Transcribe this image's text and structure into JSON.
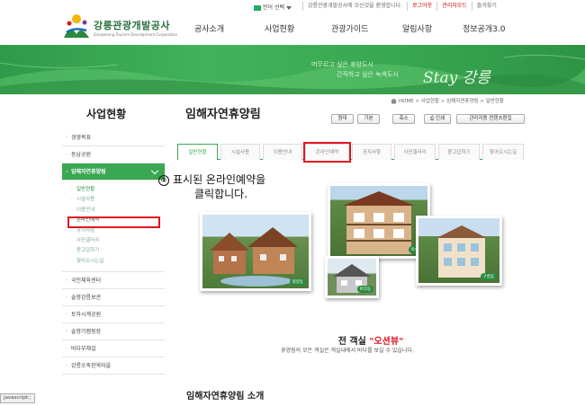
{
  "utilbar": {
    "lang_label": "언어 선택",
    "links": [
      "강릉관광개발공사에 오신것을 환영합니다.",
      "로그아웃",
      "관리자모드",
      "즐겨찾기"
    ]
  },
  "header": {
    "logo_name": "강릉관광개발공사",
    "logo_eng": "Gangneung Tourism Development Corporation",
    "gnb": [
      "공사소개",
      "사업현황",
      "관광가이드",
      "알림사항",
      "정보공개3.0"
    ]
  },
  "banner": {
    "copy1": "머무르고 싶은 휴양도시",
    "copy2": "간직하고 싶은 녹색도시",
    "stay": "Stay 강릉"
  },
  "sidebar": {
    "title": "사업현황",
    "items_top": [
      "경영목표",
      "동남공원"
    ],
    "active": "임해자연휴양림",
    "sub": [
      "일반현황",
      "시설사용",
      "이용안내",
      "온라인예약",
      "공지사항",
      "사진갤러리",
      "묻고답하기",
      "찾아오시는길"
    ],
    "items_bottom": [
      "국민체육센터",
      "솔향강릉보관",
      "토하시계공원",
      "솔향기캠핑장",
      "바다부채길",
      "강릉오죽한옥마을"
    ]
  },
  "main": {
    "page_title": "임해자연휴양림",
    "breadcrumb": [
      "HOME",
      "사업현황",
      "임해자연휴양림",
      "일반현황"
    ],
    "buttons": [
      "원대",
      "기본",
      "축소",
      "인쇄",
      "관리자용 컨텐츠편집"
    ],
    "tabs": [
      "일반현황",
      "시설사용",
      "이용안내",
      "온라인예약",
      "공지사항",
      "사진갤러리",
      "묻고답하기",
      "찾아오시는길"
    ],
    "note_num": "②",
    "note_line1": "표시된 온라인예약을",
    "note_line2": "클릭합니다.",
    "photo_caps": [
      "휘양동",
      "숙숙동",
      "바다동",
      "구름동"
    ],
    "caption_prefix": "전 객실",
    "caption_highlight": "\"오션뷰\"",
    "caption_sub": "휴양림의 모든 객실은 객실내에서 바다를 보실 수 있습니다.",
    "section_title": "임해자연휴양림 소개"
  },
  "statusbar": "javascript:;",
  "colors": {
    "green": "#3aa852",
    "red": "#e0141e"
  }
}
